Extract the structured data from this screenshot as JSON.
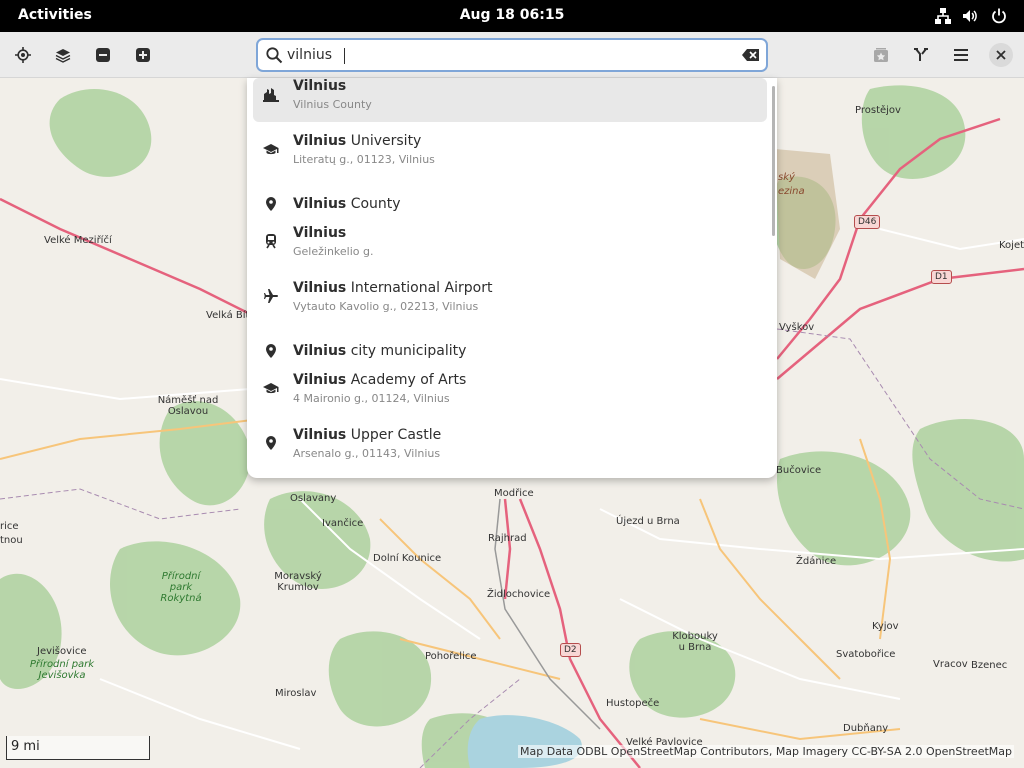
{
  "topbar": {
    "activities": "Activities",
    "clock": "Aug 18  06:15",
    "icons": [
      "network-icon",
      "volume-icon",
      "power-icon"
    ]
  },
  "header": {
    "buttons_left": [
      "locate-icon",
      "layers-icon",
      "zoom-out-icon",
      "zoom-in-icon"
    ],
    "buttons_right": [
      "favorites-icon",
      "route-icon",
      "menu-icon",
      "close-icon"
    ]
  },
  "search": {
    "value": "vilnius",
    "placeholder": ""
  },
  "results": [
    {
      "icon": "city-icon",
      "match": "Vilnius",
      "rest": "",
      "sub": "Vilnius County",
      "selected": true
    },
    {
      "icon": "education-icon",
      "match": "Vilnius",
      "rest": " University",
      "sub": "Literatų g., 01123, Vilnius",
      "selected": false
    },
    {
      "icon": "place-pin-icon",
      "match": "Vilnius",
      "rest": " County",
      "sub": "",
      "selected": false
    },
    {
      "icon": "train-icon",
      "match": "Vilnius",
      "rest": "",
      "sub": "Geležinkelio g.",
      "selected": false
    },
    {
      "icon": "airport-icon",
      "match": "Vilnius",
      "rest": " International Airport",
      "sub": "Vytauto Kavolio g., 02213, Vilnius",
      "selected": false
    },
    {
      "icon": "place-pin-icon",
      "match": "Vilnius",
      "rest": " city municipality",
      "sub": "",
      "selected": false
    },
    {
      "icon": "education-icon",
      "match": "Vilnius",
      "rest": " Academy of Arts",
      "sub": "4 Maironio g., 01124, Vilnius",
      "selected": false
    },
    {
      "icon": "place-pin-icon",
      "match": "Vilnius",
      "rest": " Upper Castle",
      "sub": "Arsenalo g., 01143, Vilnius",
      "selected": false
    }
  ],
  "map": {
    "labels": [
      "Prostějov",
      "Velké Meziříčí",
      "Velká Bíteš",
      "Náměšť nad Oslavou",
      "Vyškov",
      "Kojet",
      "Bučovice",
      "Modřice",
      "Oslavany",
      "Ivančice",
      "Rajhrad",
      "Újezd u Brna",
      "Ždánice",
      "Dolní Kounice",
      "Moravský Krumlov",
      "Židlochovice",
      "Kyjov",
      "Pohořelice",
      "Klobouky u Brna",
      "Svatobořice",
      "Vracov",
      "Bzenec",
      "Jevišovice",
      "Miroslav",
      "Hustopeče",
      "Dubňany",
      "Velké Pavlovice",
      "rice",
      "tnou",
      "ský",
      "ezina"
    ],
    "park_labels": [
      "Přírodní park Rokytná",
      "Přírodní park Jevišovka"
    ],
    "shields": [
      "D46",
      "D1",
      "D2"
    ],
    "scale": "9 mi",
    "attribution": "Map Data ODBL OpenStreetMap Contributors, Map Imagery CC-BY-SA 2.0 OpenStreetMap"
  },
  "colors": {
    "accent": "#7fa6d8",
    "headerbar": "#ebebeb",
    "selected_row": "#e8e8e8",
    "motorway": "#e5627d"
  }
}
